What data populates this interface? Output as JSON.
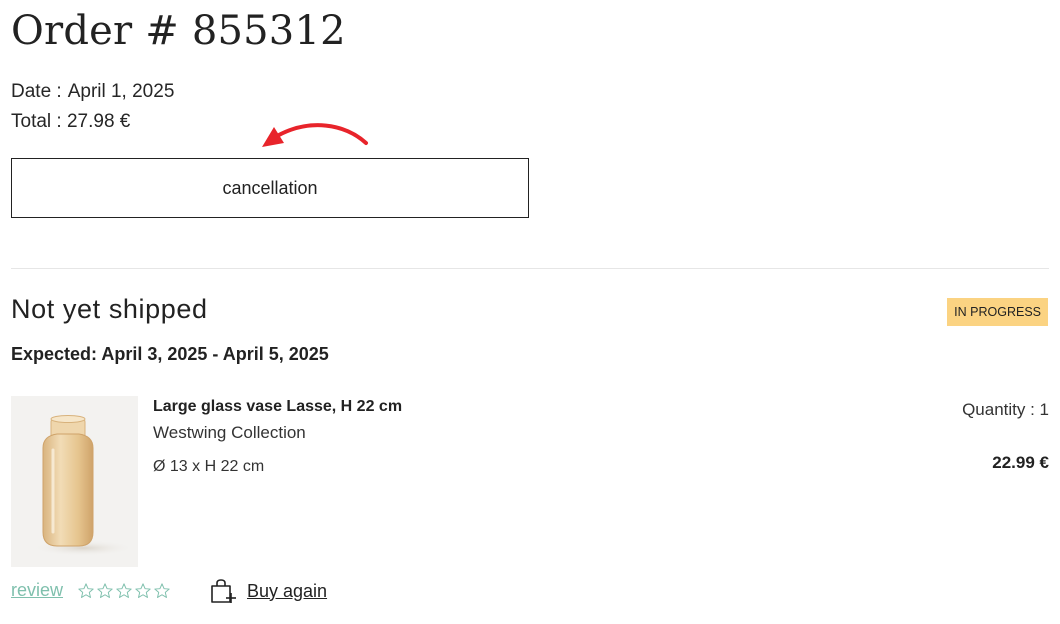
{
  "order": {
    "title": "Order # 855312",
    "date_label": "Date :",
    "date_value": "April 1, 2025",
    "total_text": "Total : 27.98 €",
    "cancel_label": "cancellation"
  },
  "annotation": {
    "arrow_color": "#e8242b"
  },
  "shipment": {
    "title": "Not yet shipped",
    "status": "IN PROGRESS",
    "status_color": "#fbd382",
    "expected": "Expected: April 3, 2025 - April 5, 2025"
  },
  "product": {
    "image_icon": "glass-vase-image",
    "name": "Large glass vase Lasse, H 22 cm",
    "brand": "Westwing Collection",
    "dimensions": "Ø 13 x H 22 cm",
    "quantity": "Quantity : 1",
    "price": "22.99 €"
  },
  "actions": {
    "review_label": "review",
    "review_color": "#7fc0ad",
    "rating_max": 5,
    "rating_value": 0,
    "buy_again_label": "Buy again",
    "buy_again_icon": "bag-plus-icon"
  }
}
